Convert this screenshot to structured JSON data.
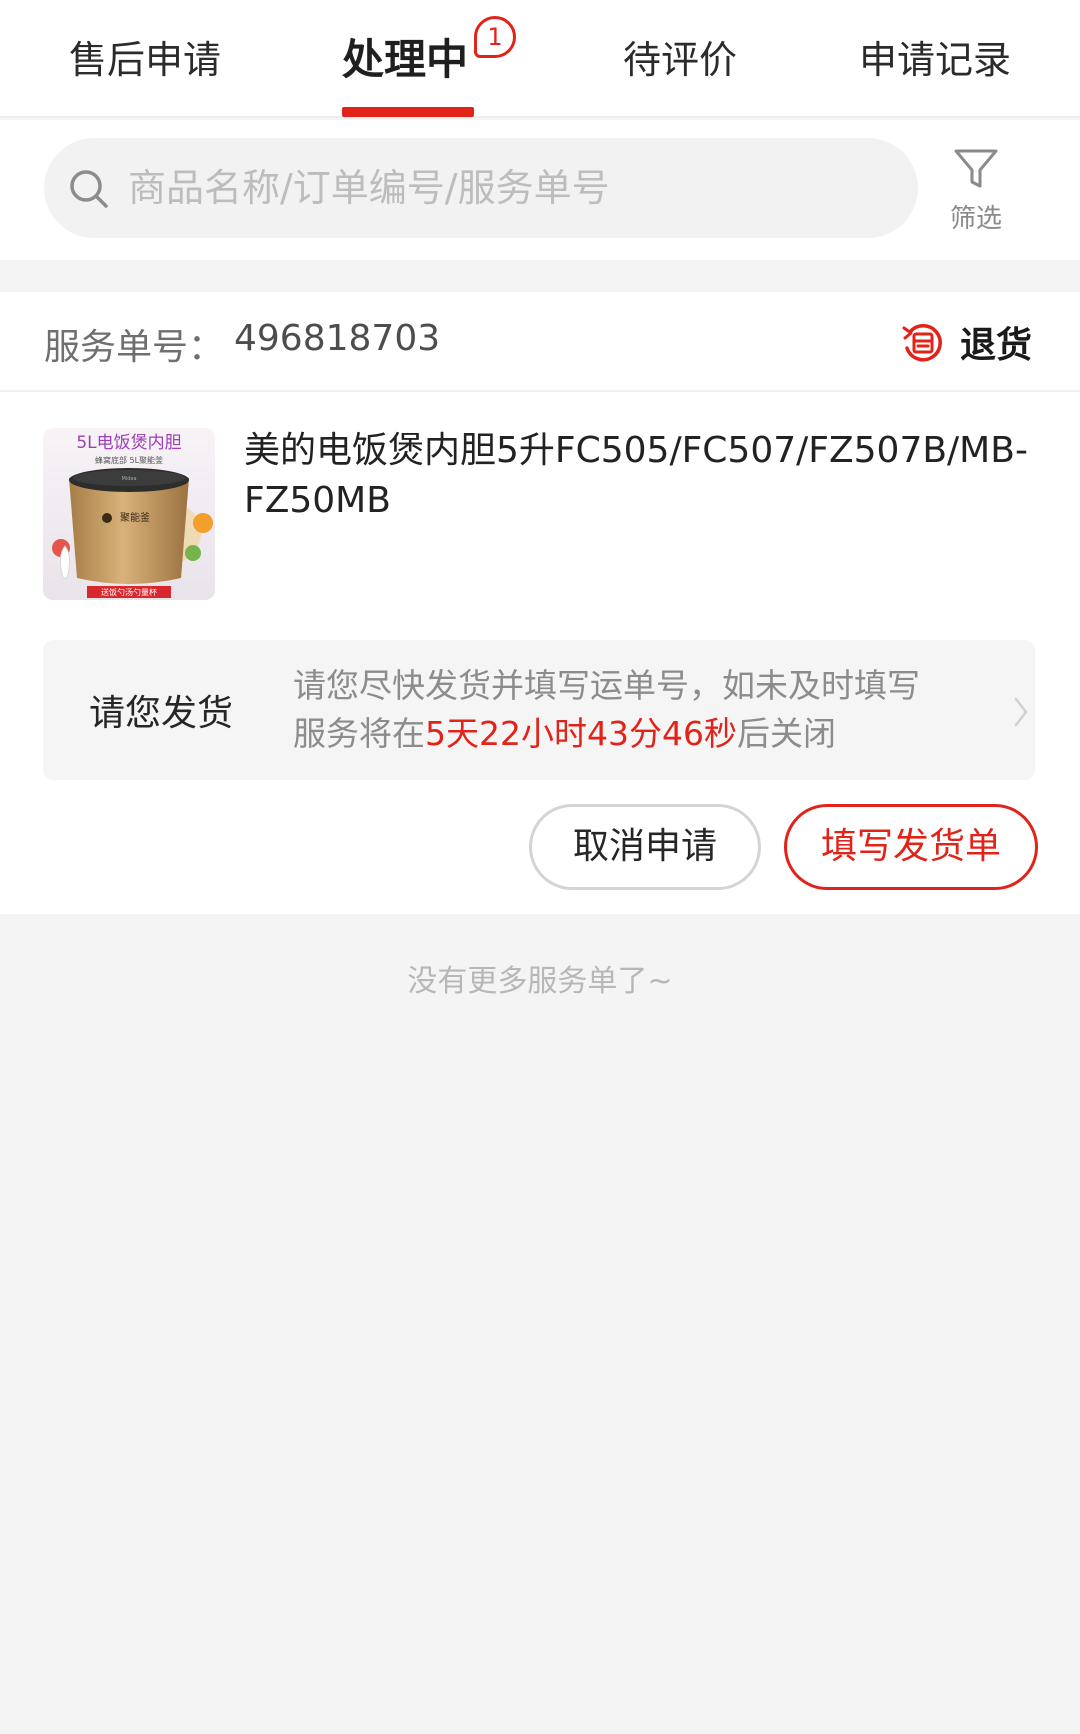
{
  "tabs": [
    {
      "label": "售后申请",
      "active": false
    },
    {
      "label": "处理中",
      "active": true,
      "badge": "1"
    },
    {
      "label": "待评价",
      "active": false
    },
    {
      "label": "申请记录",
      "active": false
    }
  ],
  "search": {
    "placeholder": "商品名称/订单编号/服务单号",
    "value": "",
    "icon": "search-icon"
  },
  "filter": {
    "label": "筛选",
    "icon": "filter-icon"
  },
  "service": {
    "order_label": "服务单号：",
    "order_number": "496818703",
    "type_label": "退货",
    "type_icon": "return-icon",
    "product_title": "美的电饭煲内胆5升FC505/FC507/FZ507B/MB-FZ50MB",
    "product_image_text": {
      "headline": "5L电饭煲内胆",
      "sub": "蜂窝底部 5L聚能釜",
      "brand": "Midea",
      "body": "聚能釜",
      "footer": "送饭勺汤勺量杯"
    },
    "notice": {
      "title": "请您发货",
      "text_line1": "请您尽快发货并填写运单号，如未及时填写",
      "text_prefix": "服务将在",
      "countdown": "5天22小时43分46秒",
      "text_suffix": "后关闭"
    },
    "buttons": {
      "cancel": "取消申请",
      "fill": "填写发货单"
    }
  },
  "footer_text": "没有更多服务单了~",
  "colors": {
    "accent": "#e2231a",
    "background": "#f4f4f4",
    "product_gold": "#c8a06a"
  }
}
